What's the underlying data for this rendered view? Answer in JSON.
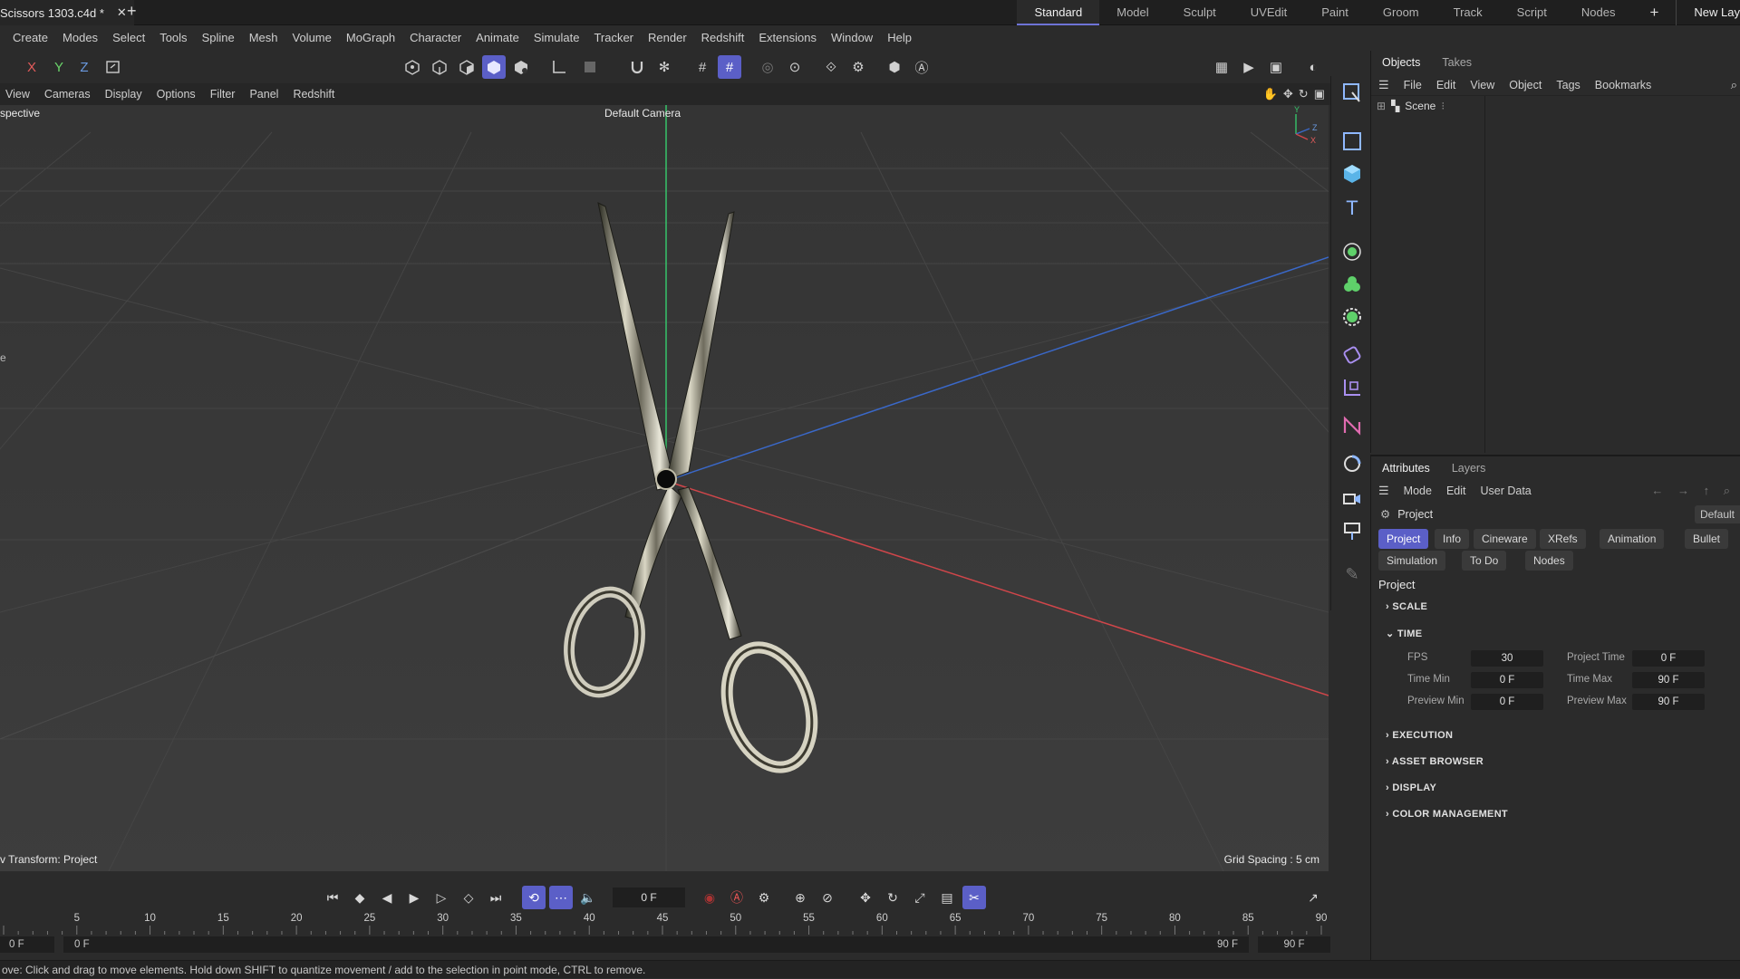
{
  "colors": {
    "accent": "#5b5fc7",
    "axis_x": "#d0464a",
    "axis_y": "#36c46a",
    "axis_z": "#3a68c8"
  },
  "document": {
    "tab_title": "Scissors 1303.c4d *",
    "close_glyph": "✕",
    "new_tab_glyph": "+"
  },
  "layouts": [
    "Standard",
    "Model",
    "Sculpt",
    "UVEdit",
    "Paint",
    "Groom",
    "Track",
    "Script",
    "Nodes",
    "+",
    "New Lay"
  ],
  "menu": [
    "Create",
    "Modes",
    "Select",
    "Tools",
    "Spline",
    "Mesh",
    "Volume",
    "MoGraph",
    "Character",
    "Animate",
    "Simulate",
    "Tracker",
    "Render",
    "Redshift",
    "Extensions",
    "Window",
    "Help"
  ],
  "toolbar": {
    "axis_x": "X",
    "axis_y": "Y",
    "axis_z": "Z"
  },
  "viewport_menu": [
    "View",
    "Cameras",
    "Display",
    "Options",
    "Filter",
    "Panel",
    "Redshift"
  ],
  "viewport": {
    "projection": "spective",
    "camera": "Default Camera",
    "transform_status": "v Transform: Project",
    "grid_spacing": "Grid Spacing : 5 cm",
    "left_marker": "e"
  },
  "objects_panel": {
    "tabs": [
      "Objects",
      "Takes"
    ],
    "menu": [
      "File",
      "Edit",
      "View",
      "Object",
      "Tags",
      "Bookmarks"
    ],
    "scene_label": "Scene"
  },
  "attributes_panel": {
    "tabs": [
      "Attributes",
      "Layers"
    ],
    "menu": [
      "Mode",
      "Edit",
      "User Data"
    ],
    "object_name": "Project",
    "preset": "Default",
    "attr_tabs_row1": [
      "Project",
      "Info",
      "Cineware",
      "XRefs",
      "Animation",
      "Bullet"
    ],
    "attr_tabs_row2": [
      "Simulation",
      "To Do",
      "Nodes"
    ],
    "group_title": "Project",
    "sections": {
      "scale": "SCALE",
      "time": "TIME",
      "execution": "EXECUTION",
      "asset_browser": "ASSET BROWSER",
      "display": "DISPLAY",
      "color_mgmt": "COLOR MANAGEMENT"
    },
    "time": {
      "fps_label": "FPS",
      "fps": "30",
      "project_time_label": "Project Time",
      "project_time": "0 F",
      "time_min_label": "Time Min",
      "time_min": "0 F",
      "time_max_label": "Time Max",
      "time_max": "90 F",
      "preview_min_label": "Preview Min",
      "preview_min": "0 F",
      "preview_max_label": "Preview Max",
      "preview_max": "90 F"
    }
  },
  "timeline": {
    "current_frame": "0 F",
    "ruler_ticks": [
      "5",
      "10",
      "15",
      "20",
      "25",
      "30",
      "35",
      "40",
      "45",
      "50",
      "55",
      "60",
      "65",
      "70",
      "75",
      "80",
      "85",
      "90"
    ],
    "range_start_field": "0 F",
    "range_start": "0 F",
    "range_end": "90 F",
    "range_end_field": "90 F"
  },
  "status": {
    "text": "ove: Click and drag to move elements. Hold down SHIFT to quantize movement / add to the selection in point mode, CTRL to remove."
  }
}
